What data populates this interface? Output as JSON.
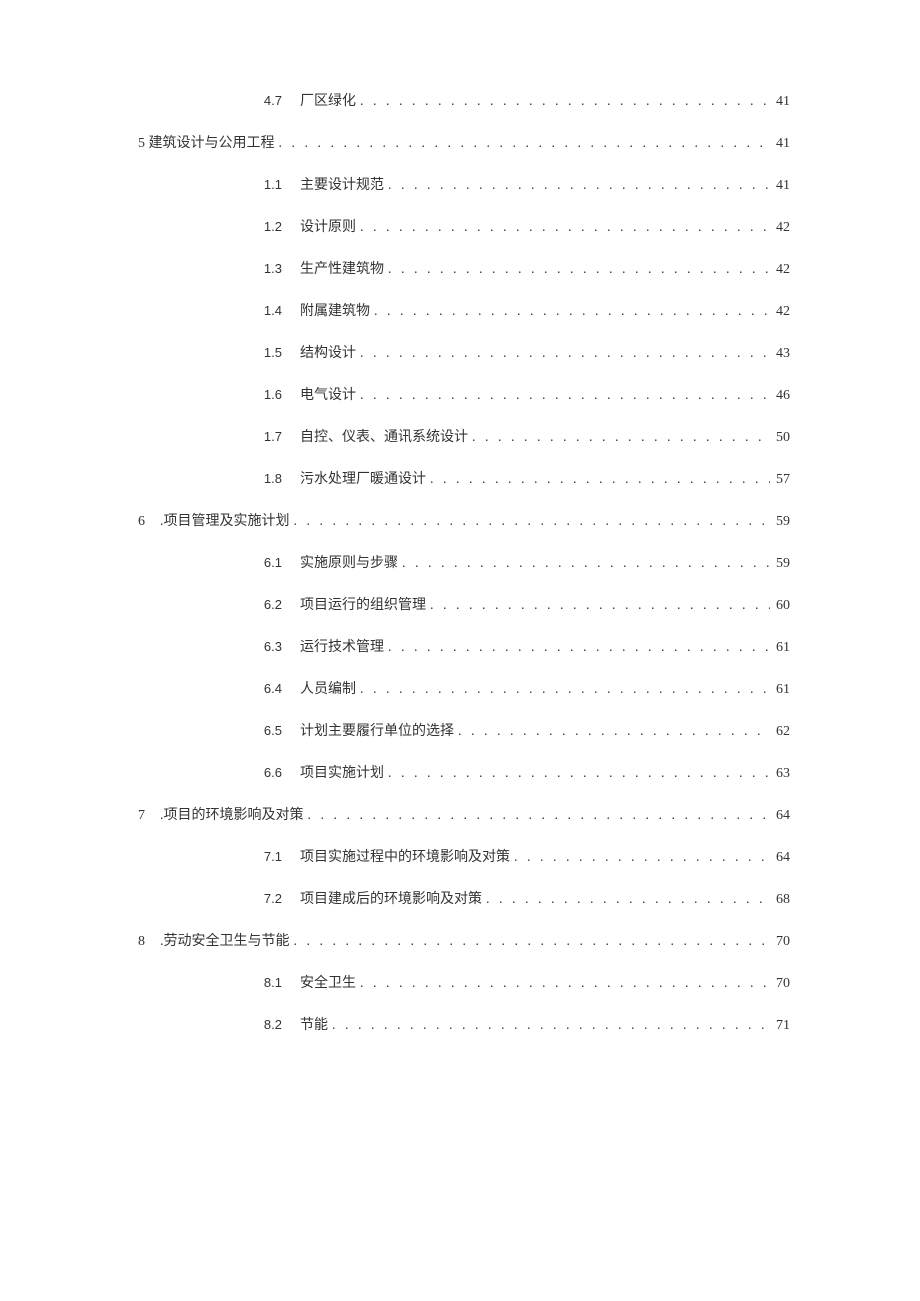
{
  "entries": [
    {
      "type": "sub",
      "num": "4.7",
      "title": "厂区绿化",
      "page": "41"
    },
    {
      "type": "chapter5",
      "prefix": "5 建筑设计与公用工程",
      "page": "41"
    },
    {
      "type": "sub",
      "num": "1.1",
      "title": "主要设计规范",
      "page": "41"
    },
    {
      "type": "sub",
      "num": "1.2",
      "title": "设计原则",
      "page": "42"
    },
    {
      "type": "sub",
      "num": "1.3",
      "title": "生产性建筑物",
      "page": "42"
    },
    {
      "type": "sub",
      "num": "1.4",
      "title": "附属建筑物",
      "page": "42"
    },
    {
      "type": "sub",
      "num": "1.5",
      "title": "结构设计",
      "page": "43"
    },
    {
      "type": "sub",
      "num": "1.6",
      "title": "电气设计",
      "page": "46"
    },
    {
      "type": "sub",
      "num": "1.7",
      "title": "自控、仪表、通讯系统设计",
      "page": "50"
    },
    {
      "type": "sub",
      "num": "1.8",
      "title": "污水处理厂暖通设计",
      "page": "57"
    },
    {
      "type": "chapter",
      "num": "6",
      "title": ".项目管理及实施计划",
      "page": "59"
    },
    {
      "type": "sub",
      "num": "6.1",
      "title": "实施原则与步骤",
      "page": "59"
    },
    {
      "type": "sub",
      "num": "6.2",
      "title": "项目运行的组织管理",
      "page": "60"
    },
    {
      "type": "sub",
      "num": "6.3",
      "title": "运行技术管理",
      "page": "61"
    },
    {
      "type": "sub",
      "num": "6.4",
      "title": "人员编制",
      "page": "61"
    },
    {
      "type": "sub",
      "num": "6.5",
      "title": "计划主要履行单位的选择",
      "page": "62"
    },
    {
      "type": "sub",
      "num": "6.6",
      "title": "项目实施计划",
      "page": "63"
    },
    {
      "type": "chapter",
      "num": "7",
      "title": ".项目的环境影响及对策",
      "page": "64"
    },
    {
      "type": "sub",
      "num": "7.1",
      "title": "项目实施过程中的环境影响及对策",
      "page": "64"
    },
    {
      "type": "sub",
      "num": "7.2",
      "title": "项目建成后的环境影响及对策",
      "page": "68"
    },
    {
      "type": "chapter",
      "num": "8",
      "title": ".劳动安全卫生与节能",
      "page": "70"
    },
    {
      "type": "sub",
      "num": "8.1",
      "title": "安全卫生",
      "page": "70"
    },
    {
      "type": "sub",
      "num": "8.2",
      "title": "节能",
      "page": "71"
    }
  ]
}
